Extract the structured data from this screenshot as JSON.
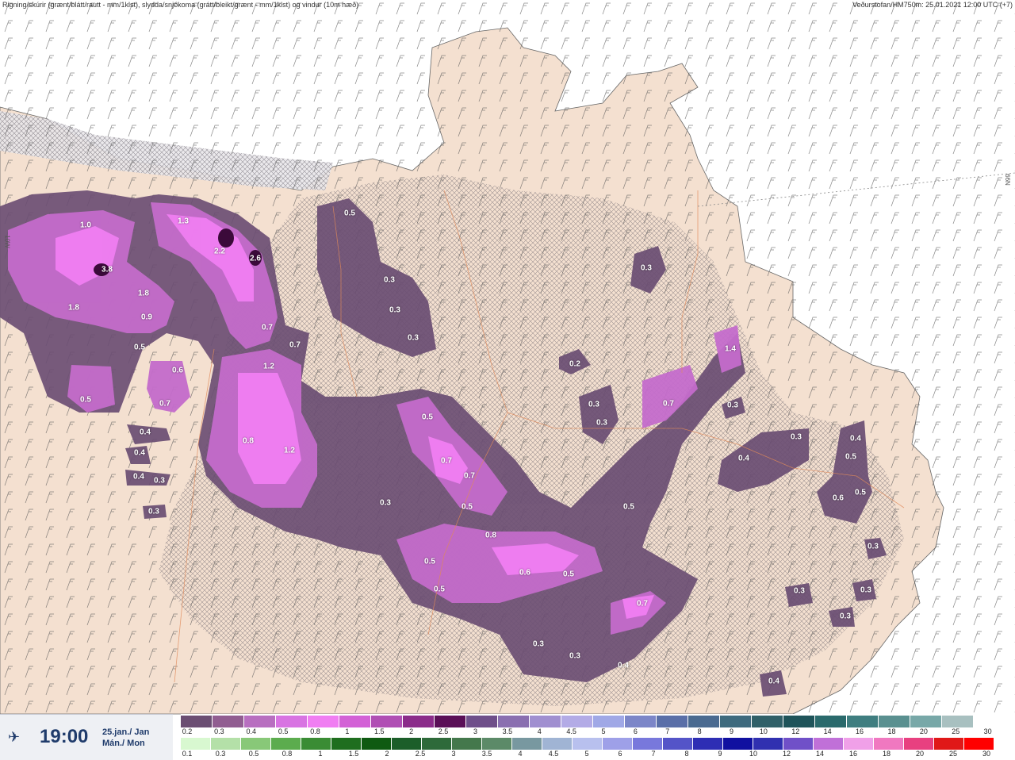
{
  "header": {
    "left": "Rigning/skúrir (grænt/blátt/rautt - mm/1klst), slydda/snjókoma (grátt/bleikt/grænt - mm/1klst) og vindur (10m hæð)",
    "right": "Veðurstofan/HM750m: 25.01.2021 12:00 UTC (+7)"
  },
  "lat_labels": {
    "right": "66N",
    "left": "10W"
  },
  "timebar": {
    "play_icon": "aircraft-play-icon",
    "time": "19:00",
    "date_line1": "25.jan./ Jan",
    "date_line2": "Mán./ Mon"
  },
  "values": [
    {
      "v": "1.0"
    },
    {
      "v": "3.8"
    },
    {
      "v": "1.8"
    },
    {
      "v": "1.8"
    },
    {
      "v": "0.9"
    },
    {
      "v": "0.5"
    },
    {
      "v": "0.6"
    },
    {
      "v": "0.7"
    },
    {
      "v": "0.5"
    },
    {
      "v": "0.4"
    },
    {
      "v": "0.4"
    },
    {
      "v": "0.4"
    },
    {
      "v": "0.3"
    },
    {
      "v": "0.3"
    },
    {
      "v": "1.3"
    },
    {
      "v": "2.2"
    },
    {
      "v": "2.6"
    },
    {
      "v": "0.7"
    },
    {
      "v": "0.7"
    },
    {
      "v": "1.2"
    },
    {
      "v": "0.8"
    },
    {
      "v": "1.2"
    },
    {
      "v": "0.5"
    },
    {
      "v": "0.3"
    },
    {
      "v": "0.3"
    },
    {
      "v": "0.3"
    },
    {
      "v": "0.3"
    },
    {
      "v": "0.2"
    },
    {
      "v": "0.3"
    },
    {
      "v": "0.3"
    },
    {
      "v": "0.5"
    },
    {
      "v": "0.7"
    },
    {
      "v": "0.7"
    },
    {
      "v": "0.5"
    },
    {
      "v": "0.8"
    },
    {
      "v": "0.3"
    },
    {
      "v": "0.5"
    },
    {
      "v": "0.5"
    },
    {
      "v": "0.6"
    },
    {
      "v": "0.5"
    },
    {
      "v": "0.5"
    },
    {
      "v": "0.7"
    },
    {
      "v": "0.3"
    },
    {
      "v": "0.3"
    },
    {
      "v": "0.4"
    },
    {
      "v": "1.4"
    },
    {
      "v": "0.7"
    },
    {
      "v": "0.3"
    },
    {
      "v": "0.3"
    },
    {
      "v": "0.4"
    },
    {
      "v": "0.4"
    },
    {
      "v": "0.5"
    },
    {
      "v": "0.6"
    },
    {
      "v": "0.5"
    },
    {
      "v": "0.3"
    },
    {
      "v": "0.3"
    },
    {
      "v": "0.3"
    },
    {
      "v": "0.3"
    },
    {
      "v": "0.4"
    }
  ],
  "legend": {
    "snow": {
      "colors": [
        "#6b4e73",
        "#915d91",
        "#b86fc0",
        "#d874e2",
        "#f07ef2",
        "#d361d6",
        "#b04fb4",
        "#8b2c8a",
        "#5a0f57",
        "#6f4f8a",
        "#8a6fb0",
        "#a08fd0",
        "#b3abe6",
        "#a0a8e6",
        "#7c86c8",
        "#5a6fa8",
        "#4a6a90",
        "#3e6a7e",
        "#306068",
        "#1f545a",
        "#2a6a6c",
        "#3f7e80",
        "#5a9090",
        "#78a8a8",
        "#a8c0c0",
        "#ffffff"
      ],
      "ticks": [
        "0.2",
        "0.3",
        "0.4",
        "0.5",
        "0.8",
        "1",
        "1.5",
        "2",
        "2.5",
        "3",
        "3.5",
        "4",
        "4.5",
        "5",
        "6",
        "7",
        "8",
        "9",
        "10",
        "12",
        "14",
        "16",
        "18",
        "20",
        "25",
        "30"
      ]
    },
    "rain": {
      "colors": [
        "#d8f8d0",
        "#b4e0a8",
        "#88c878",
        "#5cac4e",
        "#3a8c34",
        "#1f6e1f",
        "#0f5a12",
        "#1c5e2a",
        "#2e6a3a",
        "#44784c",
        "#5c8a68",
        "#7898a0",
        "#a0b4d4",
        "#b8c0ee",
        "#9ea0e8",
        "#7878dc",
        "#5454c8",
        "#2e2eb4",
        "#1010a0",
        "#3030b0",
        "#7050c8",
        "#c070d8",
        "#f0a0e8",
        "#f078c0",
        "#e84080",
        "#e01818",
        "#ff0000"
      ],
      "ticks": [
        "0.1",
        "0.3",
        "0.5",
        "0.8",
        "1",
        "1.5",
        "2",
        "2.5",
        "3",
        "3.5",
        "4",
        "4.5",
        "5",
        "6",
        "7",
        "8",
        "9",
        "10",
        "12",
        "14",
        "16",
        "18",
        "20",
        "25",
        "30"
      ]
    }
  }
}
